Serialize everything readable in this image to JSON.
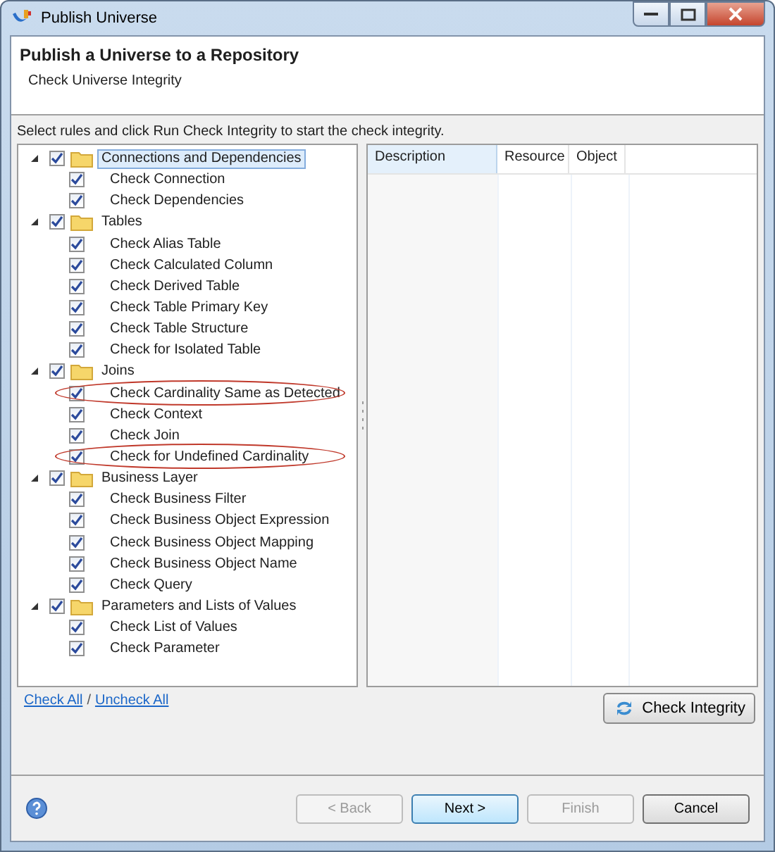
{
  "window": {
    "title": "Publish Universe"
  },
  "header": {
    "title": "Publish a Universe to a Repository",
    "subtitle": "Check Universe Integrity"
  },
  "instructions": "Select rules and click Run Check Integrity to start the check integrity.",
  "tree": [
    {
      "label": "Connections and Dependencies",
      "expanded": true,
      "checked": true,
      "selected": true,
      "children": [
        {
          "label": "Check Connection",
          "checked": true,
          "highlighted": false
        },
        {
          "label": "Check Dependencies",
          "checked": true,
          "highlighted": false
        }
      ]
    },
    {
      "label": "Tables",
      "expanded": true,
      "checked": true,
      "selected": false,
      "children": [
        {
          "label": "Check Alias Table",
          "checked": true,
          "highlighted": false
        },
        {
          "label": "Check Calculated Column",
          "checked": true,
          "highlighted": false
        },
        {
          "label": "Check Derived Table",
          "checked": true,
          "highlighted": false
        },
        {
          "label": "Check Table Primary Key",
          "checked": true,
          "highlighted": false
        },
        {
          "label": "Check Table Structure",
          "checked": true,
          "highlighted": false
        },
        {
          "label": "Check for Isolated Table",
          "checked": true,
          "highlighted": false
        }
      ]
    },
    {
      "label": "Joins",
      "expanded": true,
      "checked": true,
      "selected": false,
      "children": [
        {
          "label": "Check Cardinality Same as Detected",
          "checked": true,
          "highlighted": true
        },
        {
          "label": "Check Context",
          "checked": true,
          "highlighted": false
        },
        {
          "label": "Check Join",
          "checked": true,
          "highlighted": false
        },
        {
          "label": "Check for Undefined Cardinality",
          "checked": true,
          "highlighted": true
        }
      ]
    },
    {
      "label": "Business Layer",
      "expanded": true,
      "checked": true,
      "selected": false,
      "children": [
        {
          "label": "Check Business Filter",
          "checked": true,
          "highlighted": false
        },
        {
          "label": "Check Business Object Expression",
          "checked": true,
          "highlighted": false
        },
        {
          "label": "Check Business Object Mapping",
          "checked": true,
          "highlighted": false
        },
        {
          "label": "Check Business Object Name",
          "checked": true,
          "highlighted": false
        },
        {
          "label": "Check Query",
          "checked": true,
          "highlighted": false
        }
      ]
    },
    {
      "label": "Parameters and Lists of Values",
      "expanded": true,
      "checked": true,
      "selected": false,
      "children": [
        {
          "label": "Check List of Values",
          "checked": true,
          "highlighted": false
        },
        {
          "label": "Check Parameter",
          "checked": true,
          "highlighted": false
        }
      ]
    }
  ],
  "table": {
    "columns": [
      "Description",
      "Resource",
      "Object"
    ]
  },
  "links": [
    {
      "label": "Check All"
    },
    {
      "label": "Uncheck All"
    }
  ],
  "link_separator": "/",
  "check_button": "Check Integrity",
  "buttons": [
    {
      "label": "< Back",
      "disabled": true,
      "default": false
    },
    {
      "label": "Next >",
      "disabled": false,
      "default": true
    },
    {
      "label": "Finish",
      "disabled": true,
      "default": false
    },
    {
      "label": "Cancel",
      "disabled": false,
      "default": false
    }
  ]
}
